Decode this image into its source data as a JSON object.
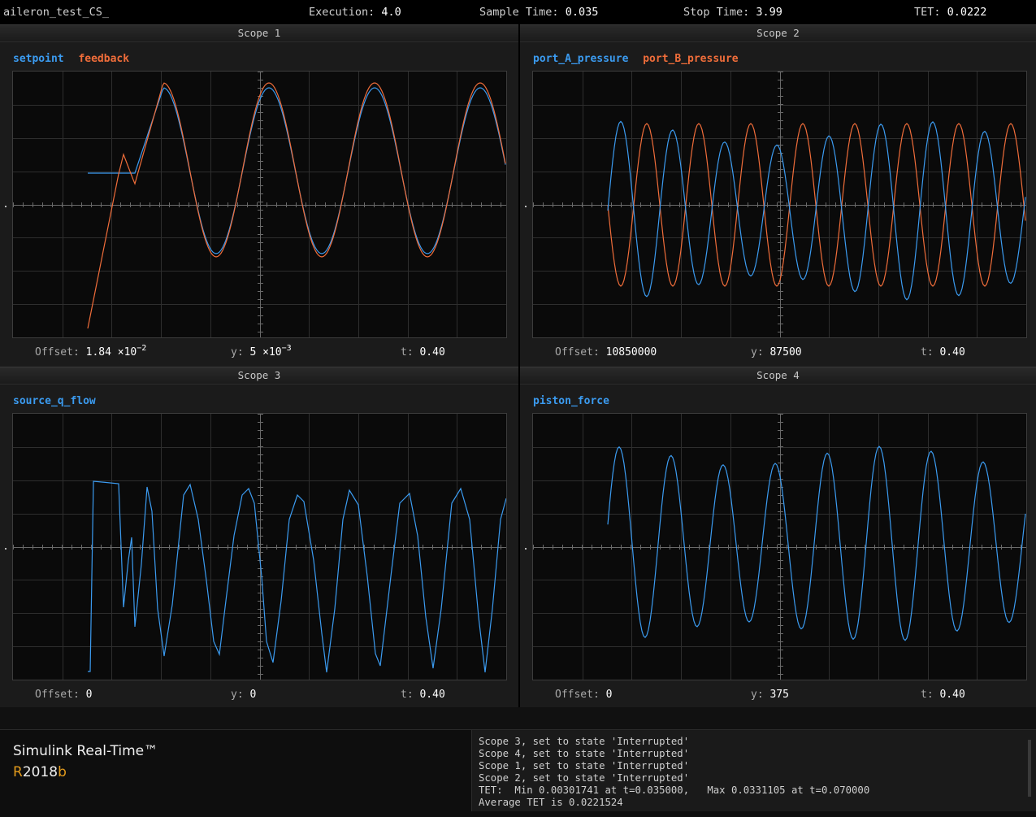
{
  "topbar": {
    "app_name": "aileron_test_CS_",
    "execution_label": "Execution:",
    "execution_value": "4.0",
    "sample_label": "Sample Time:",
    "sample_value": "0.035",
    "stop_label": "Stop Time:",
    "stop_value": "3.99",
    "tet_label": "TET:",
    "tet_value": "0.0222"
  },
  "colors": {
    "blue": "#3b9bf0",
    "orange": "#f06d3a",
    "accent": "#e29a1c"
  },
  "scopes": [
    {
      "title": "Scope 1",
      "signals": [
        "setpoint",
        "feedback"
      ],
      "offset_label": "Offset:",
      "offset_mantissa": "1.84",
      "offset_times": "×",
      "offset_base": "10",
      "offset_exp": "−2",
      "y_label": "y:",
      "y_mantissa": "5",
      "y_times": "×",
      "y_base": "10",
      "y_exp": "−3",
      "t_label": "t:",
      "t_value": "0.40"
    },
    {
      "title": "Scope 2",
      "signals": [
        "port_A_pressure",
        "port_B_pressure"
      ],
      "offset_label": "Offset:",
      "offset_value": "10850000",
      "y_label": "y:",
      "y_value": "87500",
      "t_label": "t:",
      "t_value": "0.40"
    },
    {
      "title": "Scope 3",
      "signals": [
        "source_q_flow"
      ],
      "offset_label": "Offset:",
      "offset_value": "0",
      "y_label": "y:",
      "y_value": "0",
      "t_label": "t:",
      "t_value": "0.40"
    },
    {
      "title": "Scope 4",
      "signals": [
        "piston_force"
      ],
      "offset_label": "Offset:",
      "offset_value": "0",
      "y_label": "y:",
      "y_value": "375",
      "t_label": "t:",
      "t_value": "0.40"
    }
  ],
  "brand": {
    "product": "Simulink Real-Time™",
    "release_r": "R",
    "release_year": "2018",
    "release_b": "b"
  },
  "log": [
    "Scope 3, set to state 'Interrupted'",
    "Scope 4, set to state 'Interrupted'",
    "Scope 1, set to state 'Interrupted'",
    "Scope 2, set to state 'Interrupted'",
    "TET:  Min 0.00301741 at t=0.035000,   Max 0.0331105 at t=0.070000",
    "Average TET is 0.0221524"
  ]
}
